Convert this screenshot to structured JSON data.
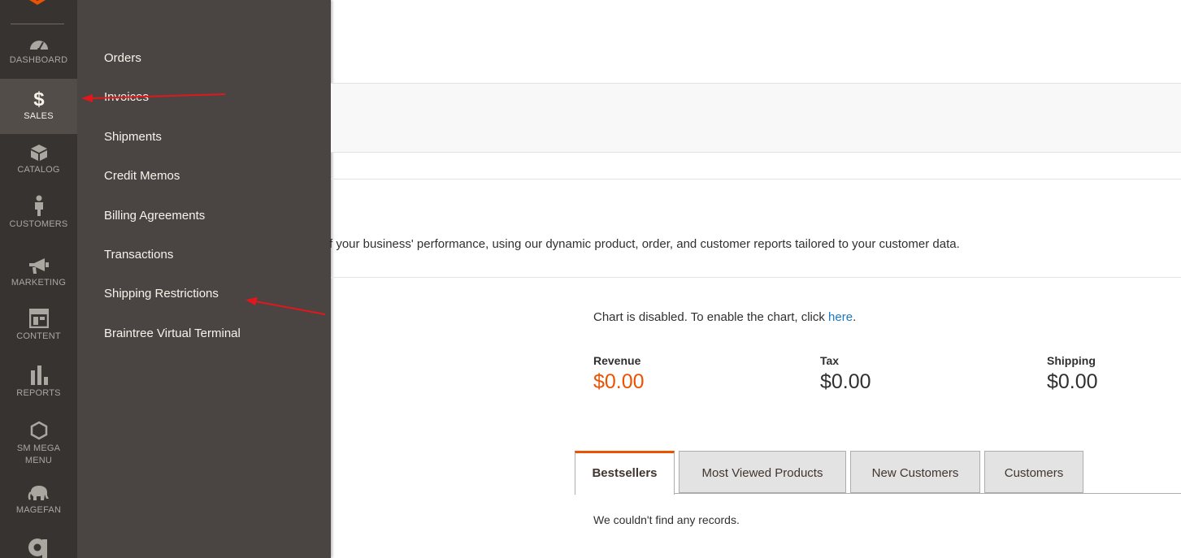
{
  "nav": {
    "items": [
      {
        "label": "DASHBOARD",
        "icon": "dashboard-icon"
      },
      {
        "label": "SALES",
        "icon": "dollar-icon",
        "active": true
      },
      {
        "label": "CATALOG",
        "icon": "box-icon"
      },
      {
        "label": "CUSTOMERS",
        "icon": "person-icon"
      },
      {
        "label": "MARKETING",
        "icon": "megaphone-icon"
      },
      {
        "label": "CONTENT",
        "icon": "layout-icon"
      },
      {
        "label": "REPORTS",
        "icon": "bar-chart-icon"
      },
      {
        "label": "SM MEGA MENU",
        "icon": "hexagon-icon"
      },
      {
        "label": "MAGEFAN",
        "icon": "elephant-icon"
      }
    ]
  },
  "submenu": {
    "items": [
      "Orders",
      "Invoices",
      "Shipments",
      "Credit Memos",
      "Billing Agreements",
      "Transactions",
      "Shipping Restrictions",
      "Braintree Virtual Terminal"
    ]
  },
  "main": {
    "intro": "f your business' performance, using our dynamic product, order, and customer reports tailored to your customer data.",
    "chart_msg_prefix": "Chart is disabled. To enable the chart, click ",
    "chart_msg_link": "here",
    "chart_msg_suffix": ".",
    "totals": [
      {
        "label": "Revenue",
        "value": "$0.00"
      },
      {
        "label": "Tax",
        "value": "$0.00"
      },
      {
        "label": "Shipping",
        "value": "$0.00"
      }
    ],
    "tabs": [
      "Bestsellers",
      "Most Viewed Products",
      "New Customers",
      "Customers"
    ],
    "empty_message": "We couldn't find any records."
  },
  "colors": {
    "nav_bg": "#373330",
    "submenu_bg": "#4a4542",
    "accent": "#eb5202",
    "link": "#1979c3",
    "annotation": "#e2171d"
  }
}
